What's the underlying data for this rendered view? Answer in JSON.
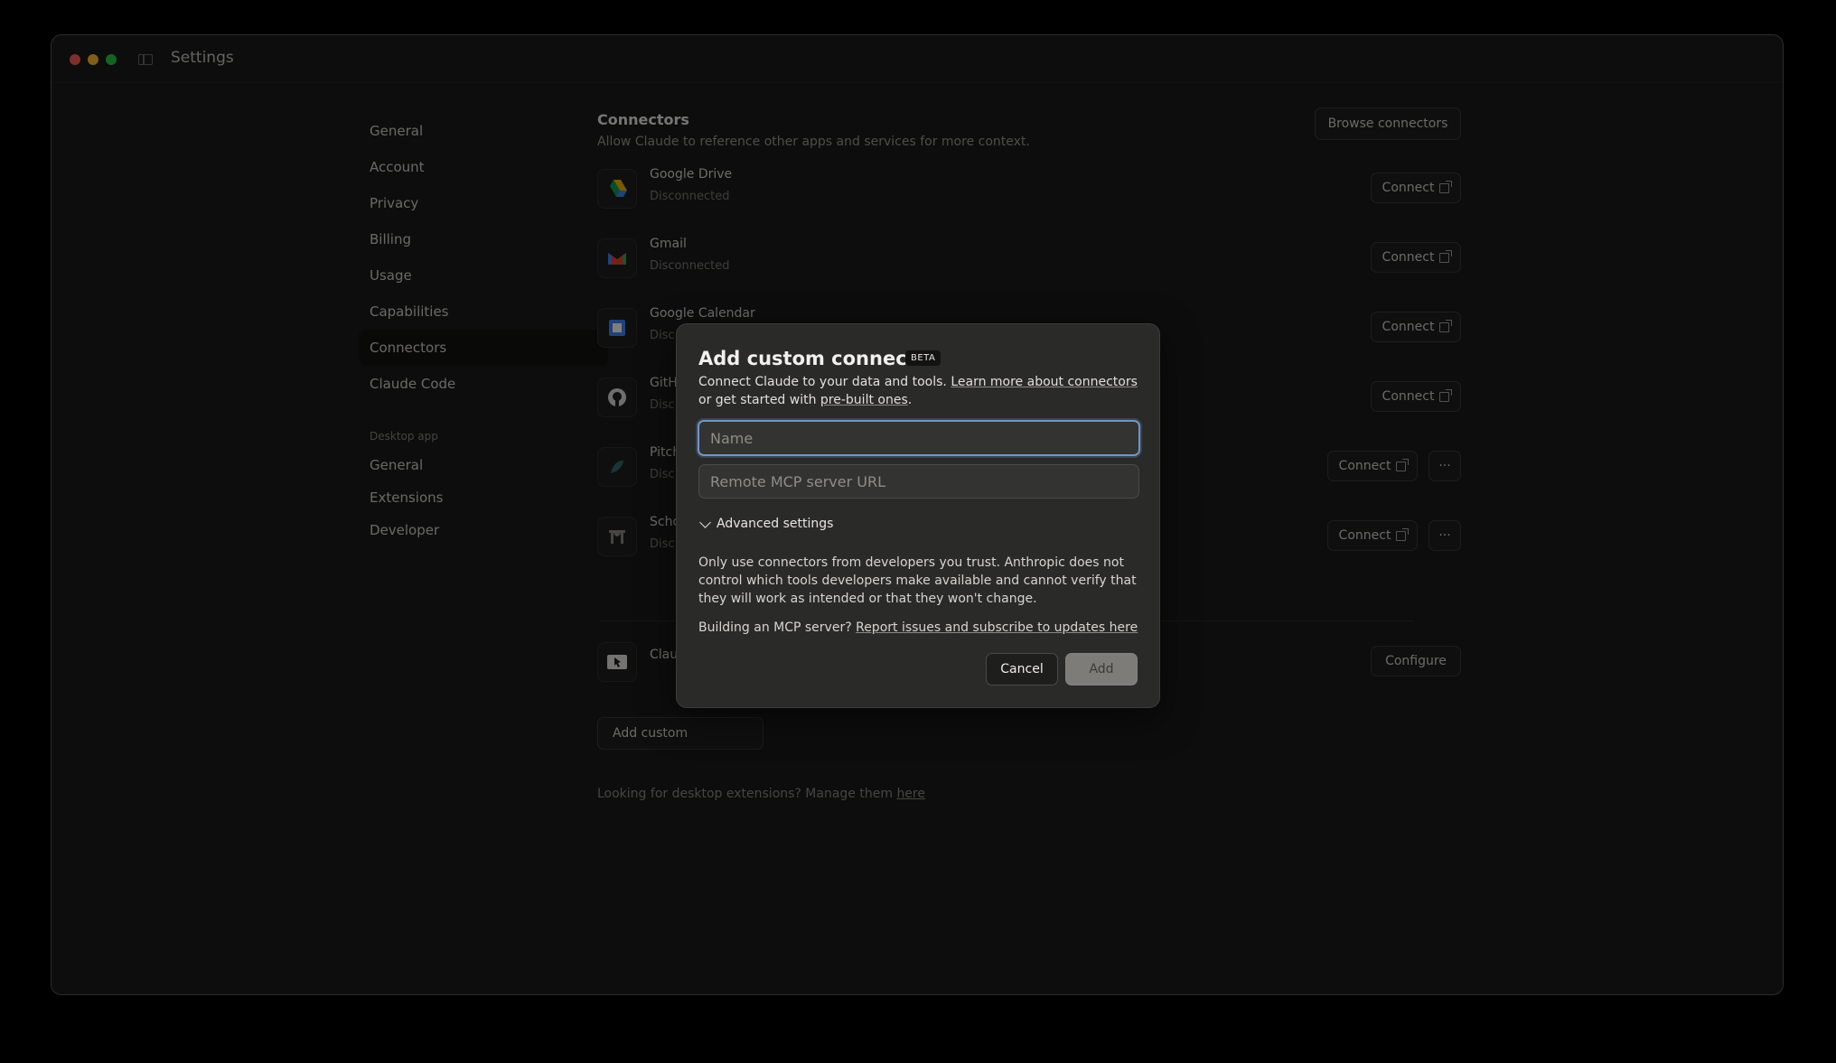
{
  "window": {
    "title": "Settings"
  },
  "nav": {
    "items": [
      "General",
      "Account",
      "Privacy",
      "Billing",
      "Usage",
      "Capabilities",
      "Connectors",
      "Claude Code"
    ],
    "active": "Connectors",
    "desktop_section": "Desktop app",
    "desktop_items": [
      "General",
      "Extensions",
      "Developer"
    ]
  },
  "connectors": {
    "title": "Connectors",
    "subtitle": "Allow Claude to reference other apps and services for more context.",
    "browse_label": "Browse connectors",
    "connect_label": "Connect",
    "configure_label": "Configure",
    "more_label": "···",
    "rows": [
      {
        "name": "Google Drive",
        "status": "Disconnected"
      },
      {
        "name": "Gmail",
        "status": "Disconnected"
      },
      {
        "name": "Google Calendar",
        "status": "Disc"
      },
      {
        "name": "GitH",
        "status": "Disc"
      },
      {
        "name": "Pitch",
        "status": "Disc"
      },
      {
        "name": "Scho",
        "status": "Disc"
      },
      {
        "name": "Clau",
        "status": ""
      }
    ],
    "add_custom_label": "Add custom",
    "footnote_text": "Looking for desktop extensions? Manage them ",
    "footnote_link": "here"
  },
  "modal": {
    "title": "Add custom connector",
    "badge": "BETA",
    "desc_1": "Connect Claude to your data and tools. ",
    "desc_link_1": "Learn more about connectors",
    "desc_2": " or get started with ",
    "desc_link_2": "pre-built ones",
    "desc_3": ".",
    "name_placeholder": "Name",
    "url_placeholder": "Remote MCP server URL",
    "advanced_label": "Advanced settings",
    "warning": "Only use connectors from developers you trust. Anthropic does not control which tools developers make available and cannot verify that they will work as intended or that they won't change.",
    "building_text": "Building an MCP server? ",
    "building_link": "Report issues and subscribe to updates here",
    "cancel_label": "Cancel",
    "add_label": "Add"
  },
  "colors": {
    "focus_ring": "#6f95c9",
    "window_bg": "#1b1b1a",
    "modal_bg": "#2a2a28"
  }
}
